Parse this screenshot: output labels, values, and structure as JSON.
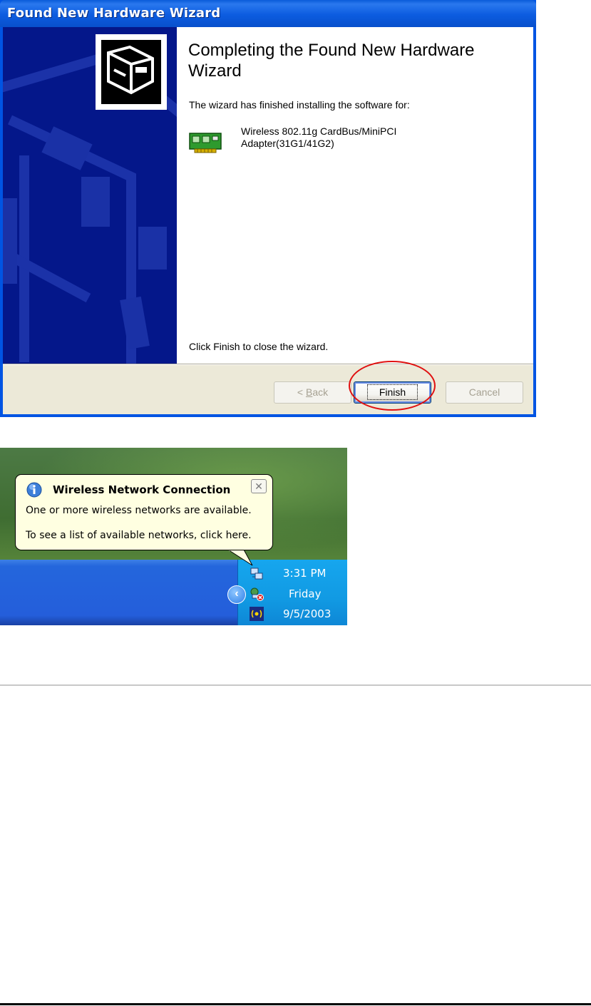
{
  "wizard": {
    "title": "Found New Hardware Wizard",
    "heading": "Completing the Found New Hardware Wizard",
    "intro": "The wizard has finished installing the software for:",
    "device_name": "Wireless 802.11g CardBus/MiniPCI Adapter(31G1/41G2)",
    "outro": "Click Finish to close the wizard.",
    "buttons": {
      "back_prefix": "< ",
      "back_mnemonic": "B",
      "back_rest": "ack",
      "finish": "Finish",
      "cancel": "Cancel"
    },
    "icons": {
      "banner": "hardware-box-icon",
      "device": "network-card-icon"
    },
    "colors": {
      "titlebar": "#0054e3",
      "left_panel": "#04178a",
      "highlight_circle": "#e01010"
    }
  },
  "notification": {
    "title": "Wireless Network Connection",
    "line1": "One or more wireless networks are available.",
    "line2": "To see a list of available networks, click here.",
    "close": "✕",
    "icon": "info-icon"
  },
  "tray": {
    "time": "3:31 PM",
    "day": "Friday",
    "date": "9/5/2003",
    "expand": "‹",
    "icons": [
      "network-connection-icon",
      "disconnected-network-icon",
      "wireless-utility-icon"
    ]
  }
}
